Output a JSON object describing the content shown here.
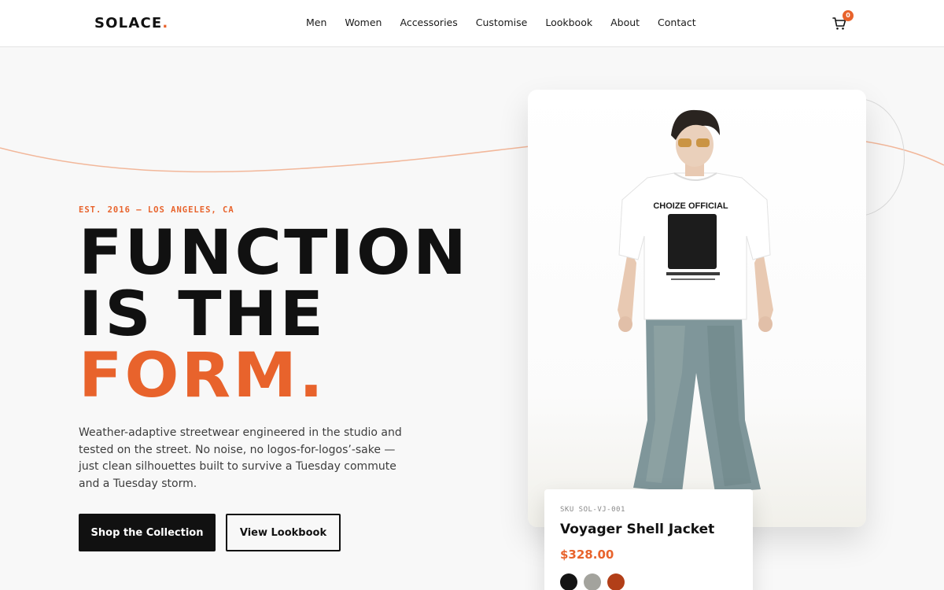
{
  "brand": {
    "name": "SOLACE",
    "dot": "."
  },
  "nav": {
    "items": [
      {
        "label": "Men"
      },
      {
        "label": "Women"
      },
      {
        "label": "Accessories"
      },
      {
        "label": "Customise"
      },
      {
        "label": "Lookbook"
      },
      {
        "label": "About"
      },
      {
        "label": "Contact"
      }
    ]
  },
  "cart": {
    "icon": "cart-icon",
    "count": "0"
  },
  "hero": {
    "eyebrow": "EST. 2016 — LOS ANGELES, CA",
    "headline_line1": "FUNCTION",
    "headline_line2": "IS THE",
    "headline_line3": "FORM.",
    "description": "Weather-adaptive streetwear engineered in the studio and tested on the street. No noise, no logos-for-logos’-sake — just clean silhouettes built to survive a Tuesday commute and a Tuesday storm.",
    "primary_cta": "Shop the Collection",
    "secondary_cta": "View Lookbook"
  },
  "feature_image": {
    "shirt_text": "CHOIZE OFFICIAL"
  },
  "product": {
    "sku": "SKU SOL-VJ-001",
    "name": "Voyager Shell Jacket",
    "price": "$328.00",
    "swatches": [
      {
        "name": "black",
        "color": "#141414"
      },
      {
        "name": "grey",
        "color": "#a3a39d"
      },
      {
        "name": "rust",
        "color": "#b23f18"
      }
    ]
  },
  "colors": {
    "accent": "#e8632c",
    "ink": "#111111",
    "background": "#f8f8f8"
  }
}
